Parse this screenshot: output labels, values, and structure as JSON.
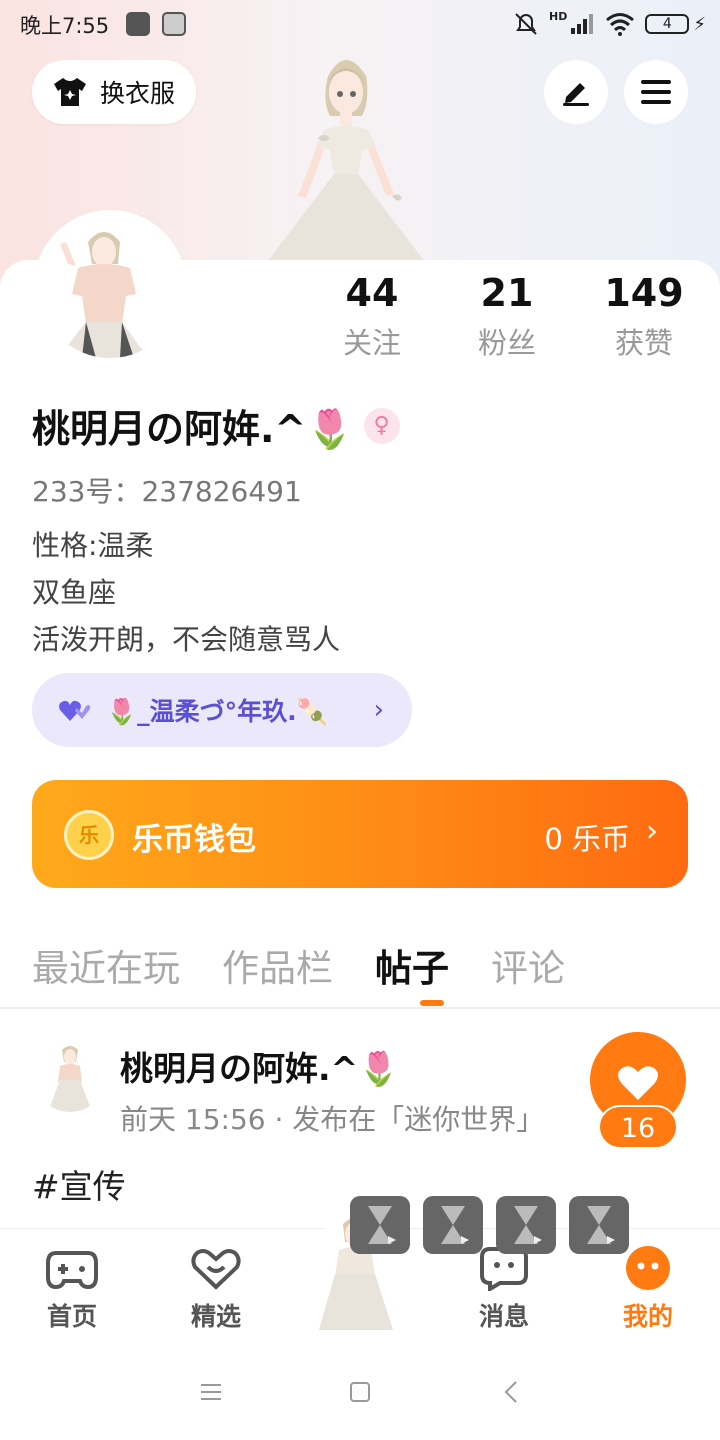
{
  "status_bar": {
    "time": "晚上7:55",
    "network": "HD",
    "battery": "4"
  },
  "header": {
    "outfit_button": "换衣服"
  },
  "stats": [
    {
      "value": "44",
      "label": "关注"
    },
    {
      "value": "21",
      "label": "粉丝"
    },
    {
      "value": "149",
      "label": "获赞"
    }
  ],
  "profile": {
    "name": "桃明月の阿姩.^🌷",
    "gender_symbol": "♀",
    "uid": "233号：237826491",
    "bio": [
      "性格:温柔",
      "双鱼座",
      "活泼开朗，不会随意骂人"
    ]
  },
  "group": {
    "label": "🌷_温柔づ°年玖.🍡",
    "chevron": "›"
  },
  "wallet": {
    "title": "乐币钱包",
    "coin_label": "乐",
    "balance": "0 乐币",
    "chevron": "›"
  },
  "tabs": [
    {
      "label": "最近在玩",
      "active": false
    },
    {
      "label": "作品栏",
      "active": false
    },
    {
      "label": "帖子",
      "active": true
    },
    {
      "label": "评论",
      "active": false
    }
  ],
  "post": {
    "author": "桃明月の阿姩.^🌷",
    "meta": "前天 15:56 · 发布在「迷你世界」",
    "text": "#宣传",
    "likes": "16"
  },
  "bottom_nav": [
    {
      "label": "首页",
      "icon": "gamepad-icon"
    },
    {
      "label": "精选",
      "icon": "heart-box-icon"
    },
    {
      "label": "消息",
      "icon": "chat-icon"
    },
    {
      "label": "我的",
      "icon": "face-icon",
      "active": true
    }
  ],
  "colors": {
    "accent": "#ff7a10",
    "group_text": "#5a4fd6",
    "group_bg": "#ebe8fb"
  }
}
